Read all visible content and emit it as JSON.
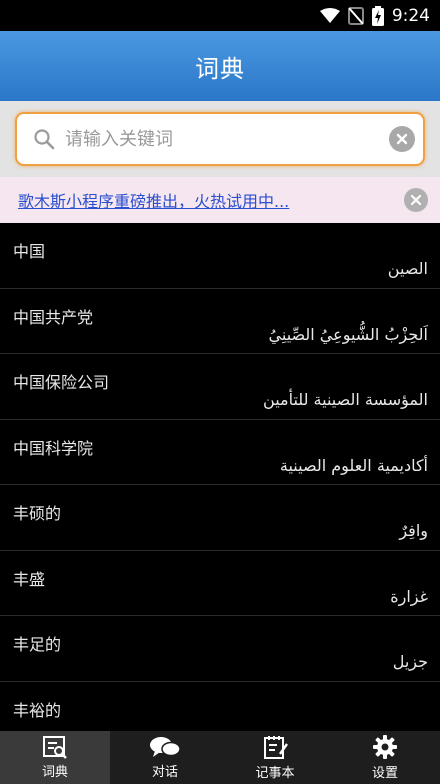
{
  "status_bar": {
    "time": "9:24",
    "icons": [
      "wifi-icon",
      "no-sim-icon",
      "battery-charging-icon"
    ]
  },
  "header": {
    "title": "词典"
  },
  "search": {
    "placeholder": "请输入关键词",
    "icon": "search-icon",
    "clear_icon": "clear-icon"
  },
  "banner": {
    "text": "歌木斯小程序重磅推出，火热试用中...",
    "close_icon": "close-icon"
  },
  "entries": [
    {
      "zh": "中国",
      "ar": "الصين"
    },
    {
      "zh": "中国共产党",
      "ar": "اَلحِزْبُ الشُّيوعِيُ الصِّينِيُ"
    },
    {
      "zh": "中国保险公司",
      "ar": "المؤسسة الصينية للتأمين"
    },
    {
      "zh": "中国科学院",
      "ar": "أكاديمية العلوم الصينية"
    },
    {
      "zh": "丰硕的",
      "ar": "وافِرٌ"
    },
    {
      "zh": "丰盛",
      "ar": "غزارة"
    },
    {
      "zh": "丰足的",
      "ar": "جزيل"
    },
    {
      "zh": "丰裕的",
      "ar": ""
    }
  ],
  "tabs": [
    {
      "label": "词典",
      "icon": "dictionary-icon",
      "active": true
    },
    {
      "label": "对话",
      "icon": "chat-icon",
      "active": false
    },
    {
      "label": "记事本",
      "icon": "notebook-icon",
      "active": false
    },
    {
      "label": "设置",
      "icon": "gear-icon",
      "active": false
    }
  ],
  "colors": {
    "header": "#3a87d6",
    "banner_bg": "#f6e6ef",
    "banner_link": "#2a4fd0",
    "search_border": "#f0a040"
  }
}
